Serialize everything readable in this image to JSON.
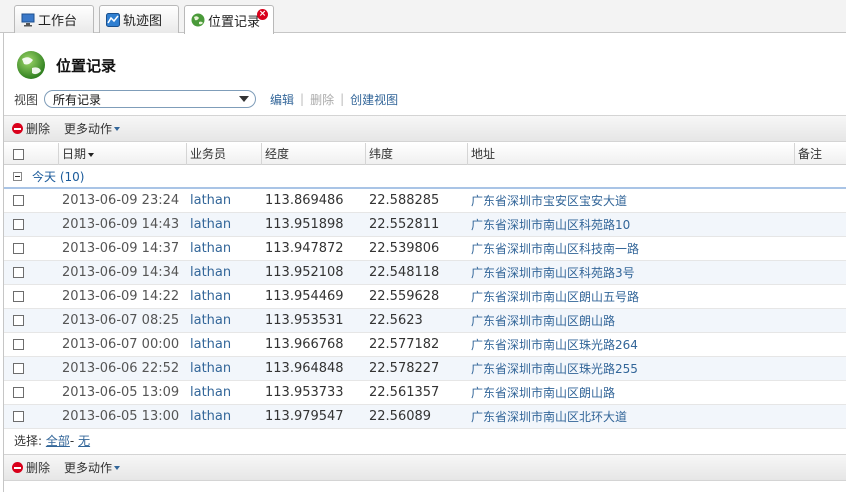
{
  "tabs": [
    {
      "label": "工作台",
      "icon": "desktop-icon"
    },
    {
      "label": "轨迹图",
      "icon": "map-icon"
    },
    {
      "label": "位置记录",
      "icon": "globe-icon",
      "active": true
    }
  ],
  "page": {
    "title": "位置记录"
  },
  "view": {
    "label": "视图",
    "selected": "所有记录",
    "edit": "编辑",
    "delete": "删除",
    "create": "创建视图"
  },
  "toolbar": {
    "delete": "删除",
    "more": "更多动作"
  },
  "table": {
    "headers": {
      "date": "日期",
      "user": "业务员",
      "lng": "经度",
      "lat": "纬度",
      "addr": "地址",
      "note": "备注"
    },
    "group": "今天 (10)",
    "rows": [
      {
        "date": "2013-06-09 23:24",
        "user": "lathan",
        "lng": "113.869486",
        "lat": "22.588285",
        "addr": "广东省深圳市宝安区宝安大道"
      },
      {
        "date": "2013-06-09 14:43",
        "user": "lathan",
        "lng": "113.951898",
        "lat": "22.552811",
        "addr": "广东省深圳市南山区科苑路10"
      },
      {
        "date": "2013-06-09 14:37",
        "user": "lathan",
        "lng": "113.947872",
        "lat": "22.539806",
        "addr": "广东省深圳市南山区科技南一路"
      },
      {
        "date": "2013-06-09 14:34",
        "user": "lathan",
        "lng": "113.952108",
        "lat": "22.548118",
        "addr": "广东省深圳市南山区科苑路3号"
      },
      {
        "date": "2013-06-09 14:22",
        "user": "lathan",
        "lng": "113.954469",
        "lat": "22.559628",
        "addr": "广东省深圳市南山区朗山五号路"
      },
      {
        "date": "2013-06-07 08:25",
        "user": "lathan",
        "lng": "113.953531",
        "lat": "22.5623",
        "addr": "广东省深圳市南山区朗山路"
      },
      {
        "date": "2013-06-07 00:00",
        "user": "lathan",
        "lng": "113.966768",
        "lat": "22.577182",
        "addr": "广东省深圳市南山区珠光路264"
      },
      {
        "date": "2013-06-06 22:52",
        "user": "lathan",
        "lng": "113.964848",
        "lat": "22.578227",
        "addr": "广东省深圳市南山区珠光路255"
      },
      {
        "date": "2013-06-05 13:09",
        "user": "lathan",
        "lng": "113.953733",
        "lat": "22.561357",
        "addr": "广东省深圳市南山区朗山路"
      },
      {
        "date": "2013-06-05 13:00",
        "user": "lathan",
        "lng": "113.979547",
        "lat": "22.56089",
        "addr": "广东省深圳市南山区北环大道"
      }
    ]
  },
  "selection": {
    "label": "选择:",
    "all": "全部",
    "sep": "-",
    "none": "无"
  }
}
